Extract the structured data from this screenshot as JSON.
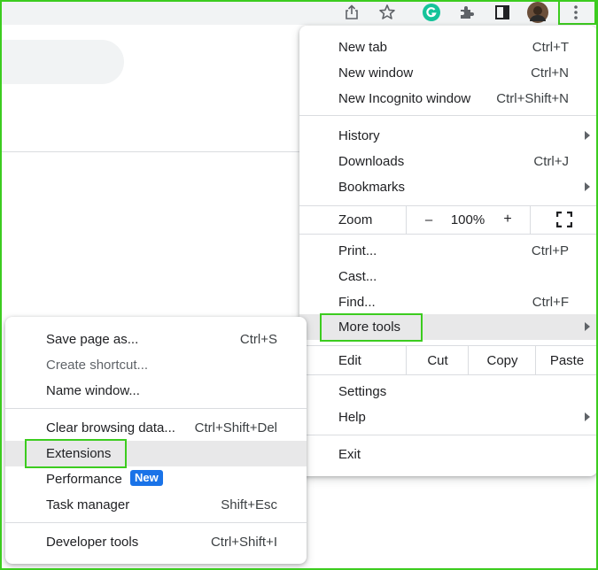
{
  "colors": {
    "highlight_box": "#3ccc1f",
    "new_badge": "#1a73e8"
  },
  "toolbar": {
    "icons": [
      "share-icon",
      "bookmark-star-icon",
      "grammarly-icon",
      "extensions-puzzle-icon",
      "side-panel-icon",
      "profile-avatar",
      "chrome-menu-icon"
    ]
  },
  "main_menu": {
    "new_tab": {
      "label": "New tab",
      "shortcut": "Ctrl+T"
    },
    "new_window": {
      "label": "New window",
      "shortcut": "Ctrl+N"
    },
    "new_incognito": {
      "label": "New Incognito window",
      "shortcut": "Ctrl+Shift+N"
    },
    "history": {
      "label": "History"
    },
    "downloads": {
      "label": "Downloads",
      "shortcut": "Ctrl+J"
    },
    "bookmarks": {
      "label": "Bookmarks"
    },
    "zoom": {
      "label": "Zoom",
      "minus": "–",
      "level": "100%",
      "plus": "+"
    },
    "print": {
      "label": "Print...",
      "shortcut": "Ctrl+P"
    },
    "cast": {
      "label": "Cast..."
    },
    "find": {
      "label": "Find...",
      "shortcut": "Ctrl+F"
    },
    "more_tools": {
      "label": "More tools"
    },
    "edit": {
      "label": "Edit",
      "cut": "Cut",
      "copy": "Copy",
      "paste": "Paste"
    },
    "settings": {
      "label": "Settings"
    },
    "help": {
      "label": "Help"
    },
    "exit": {
      "label": "Exit"
    }
  },
  "more_tools_menu": {
    "save_page": {
      "label": "Save page as...",
      "shortcut": "Ctrl+S"
    },
    "create_shortcut": {
      "label": "Create shortcut..."
    },
    "name_window": {
      "label": "Name window..."
    },
    "clear_data": {
      "label": "Clear browsing data...",
      "shortcut": "Ctrl+Shift+Del"
    },
    "extensions": {
      "label": "Extensions"
    },
    "performance": {
      "label": "Performance",
      "badge": "New"
    },
    "task_manager": {
      "label": "Task manager",
      "shortcut": "Shift+Esc"
    },
    "dev_tools": {
      "label": "Developer tools",
      "shortcut": "Ctrl+Shift+I"
    }
  }
}
